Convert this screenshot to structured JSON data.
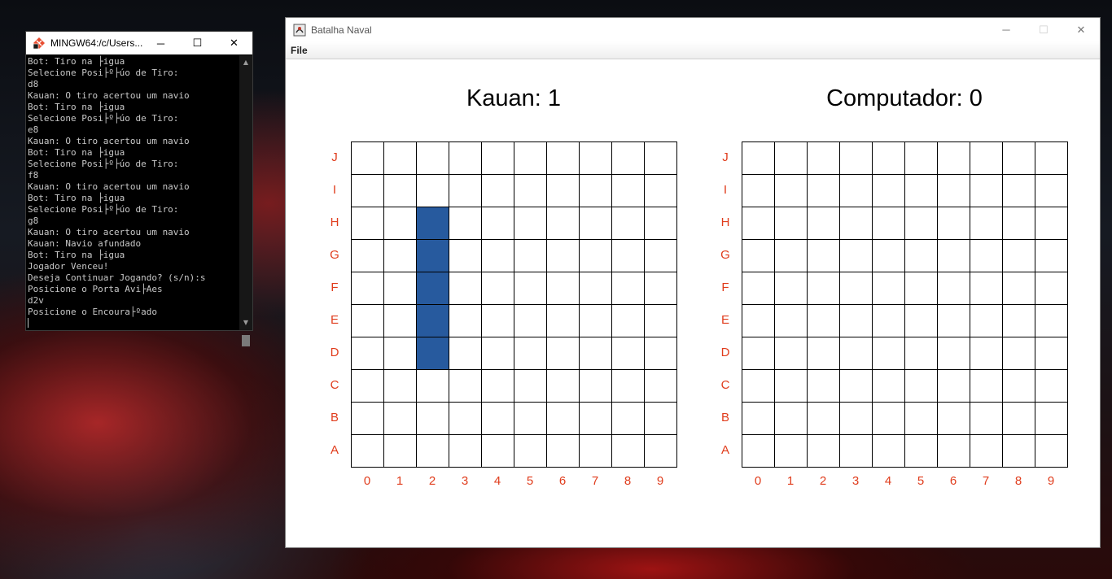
{
  "terminal": {
    "title": "MINGW64:/c/Users...",
    "controls": {
      "minimize": "─",
      "maximize": "☐",
      "close": "✕"
    },
    "lines": [
      "Bot: Tiro na ├igua",
      "Selecione Posi├º├úo de Tiro:",
      "d8",
      "Kauan: O tiro acertou um navio",
      "Bot: Tiro na ├igua",
      "Selecione Posi├º├úo de Tiro:",
      "e8",
      "Kauan: O tiro acertou um navio",
      "Bot: Tiro na ├igua",
      "Selecione Posi├º├úo de Tiro:",
      "f8",
      "Kauan: O tiro acertou um navio",
      "Bot: Tiro na ├igua",
      "Selecione Posi├º├úo de Tiro:",
      "g8",
      "Kauan: O tiro acertou um navio",
      "Kauan: Navio afundado",
      "Bot: Tiro na ├igua",
      "Jogador Venceu!",
      "Deseja Continuar Jogando? (s/n):s",
      "Posicione o Porta Avi├Aes",
      "d2v",
      "Posicione o Encoura├ºado"
    ],
    "scrollbar": {
      "up": "▲",
      "down": "▼"
    }
  },
  "window": {
    "title": "Batalha Naval",
    "controls": {
      "minimize": "─",
      "maximize": "☐",
      "close": "✕"
    },
    "menu": {
      "file": "File"
    }
  },
  "boards": [
    {
      "title": "Kauan: 1",
      "row_labels": [
        "J",
        "I",
        "H",
        "G",
        "F",
        "E",
        "D",
        "C",
        "B",
        "A"
      ],
      "col_labels": [
        "0",
        "1",
        "2",
        "3",
        "4",
        "5",
        "6",
        "7",
        "8",
        "9"
      ],
      "ship_cells": [
        [
          2,
          2
        ],
        [
          3,
          2
        ],
        [
          4,
          2
        ],
        [
          5,
          2
        ],
        [
          6,
          2
        ]
      ]
    },
    {
      "title": "Computador: 0",
      "row_labels": [
        "J",
        "I",
        "H",
        "G",
        "F",
        "E",
        "D",
        "C",
        "B",
        "A"
      ],
      "col_labels": [
        "0",
        "1",
        "2",
        "3",
        "4",
        "5",
        "6",
        "7",
        "8",
        "9"
      ],
      "ship_cells": []
    }
  ],
  "colors": {
    "ship": "#275a9e",
    "label": "#e03c1c"
  }
}
